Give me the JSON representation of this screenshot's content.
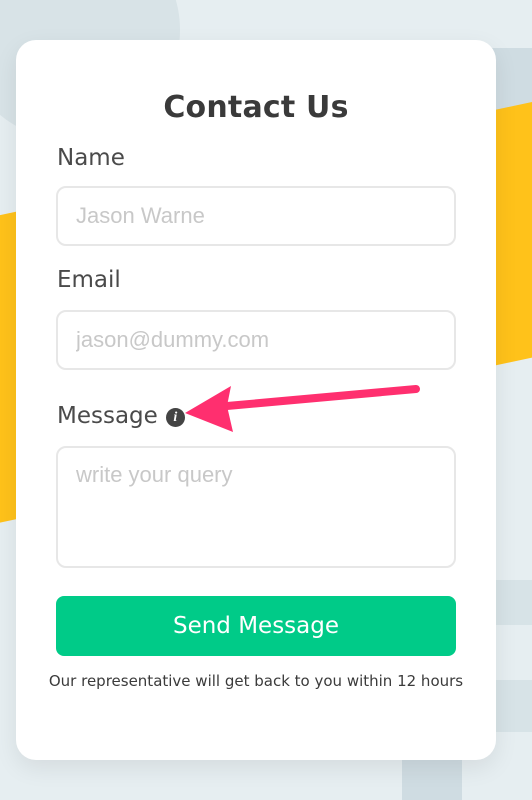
{
  "form": {
    "title": "Contact Us",
    "fields": {
      "name": {
        "label": "Name",
        "placeholder": "Jason Warne"
      },
      "email": {
        "label": "Email",
        "placeholder": "jason@dummy.com"
      },
      "message": {
        "label": "Message",
        "placeholder": "write your query"
      }
    },
    "submit_label": "Send Message",
    "note": "Our representative will get back to you within 12 hours"
  },
  "icons": {
    "info_icon": "info-icon",
    "arrow": "annotation-arrow"
  },
  "colors": {
    "primary_button": "#00cb88",
    "arrow": "#ff2f6f",
    "background_yellow": "#ffc21a",
    "text": "#4a4a4a"
  }
}
